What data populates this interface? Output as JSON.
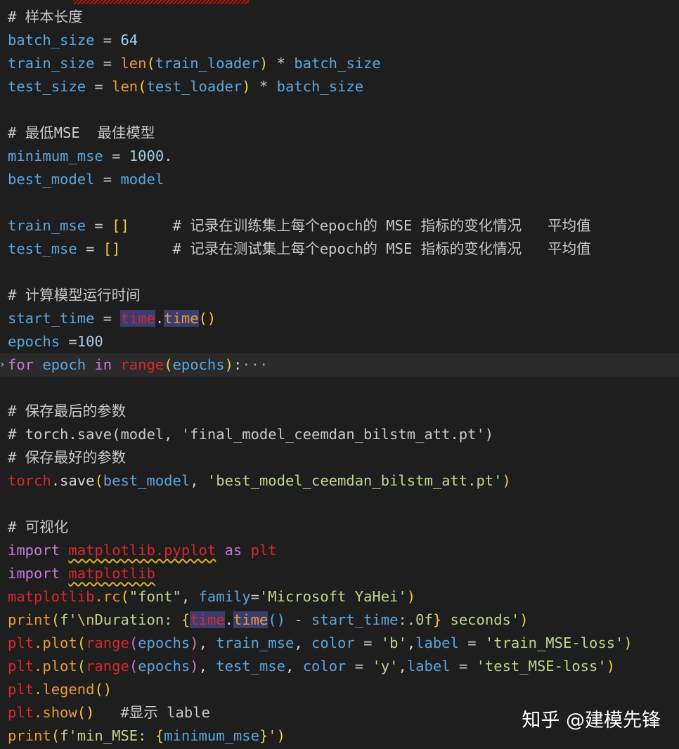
{
  "editor": {
    "lines": [
      [
        {
          "t": "# 样本长度",
          "c": "cm"
        }
      ],
      [
        {
          "t": "batch_size",
          "c": "var"
        },
        {
          "t": " = ",
          "c": "op"
        },
        {
          "t": "64",
          "c": "num"
        }
      ],
      [
        {
          "t": "train_size",
          "c": "var"
        },
        {
          "t": " = ",
          "c": "op"
        },
        {
          "t": "len",
          "c": "fn"
        },
        {
          "t": "(",
          "c": "p1"
        },
        {
          "t": "train_loader",
          "c": "var"
        },
        {
          "t": ")",
          "c": "p1"
        },
        {
          "t": " * ",
          "c": "op"
        },
        {
          "t": "batch_size",
          "c": "var"
        }
      ],
      [
        {
          "t": "test_size",
          "c": "var"
        },
        {
          "t": " = ",
          "c": "op"
        },
        {
          "t": "len",
          "c": "fn"
        },
        {
          "t": "(",
          "c": "p1"
        },
        {
          "t": "test_loader",
          "c": "var"
        },
        {
          "t": ")",
          "c": "p1"
        },
        {
          "t": " * ",
          "c": "op"
        },
        {
          "t": "batch_size",
          "c": "var"
        }
      ],
      [],
      [
        {
          "t": "# 最低MSE  最佳模型",
          "c": "cm"
        }
      ],
      [
        {
          "t": "minimum_mse",
          "c": "var"
        },
        {
          "t": " = ",
          "c": "op"
        },
        {
          "t": "1000.",
          "c": "num"
        }
      ],
      [
        {
          "t": "best_model",
          "c": "var"
        },
        {
          "t": " = ",
          "c": "op"
        },
        {
          "t": "model",
          "c": "var"
        }
      ],
      [],
      [
        {
          "t": "train_mse",
          "c": "var"
        },
        {
          "t": " = ",
          "c": "op"
        },
        {
          "t": "[]",
          "c": "p1"
        },
        {
          "t": "     # 记录在训练集上每个epoch的 MSE 指标的变化情况   平均值",
          "c": "cm"
        }
      ],
      [
        {
          "t": "test_mse",
          "c": "var"
        },
        {
          "t": " = ",
          "c": "op"
        },
        {
          "t": "[]",
          "c": "p1"
        },
        {
          "t": "      # 记录在测试集上每个epoch的 MSE 指标的变化情况   平均值",
          "c": "cm"
        }
      ],
      [],
      [
        {
          "t": "# 计算模型运行时间",
          "c": "cm"
        }
      ],
      [
        {
          "t": "start_time",
          "c": "var"
        },
        {
          "t": " = ",
          "c": "op"
        },
        {
          "t": "time",
          "c": "mod hl"
        },
        {
          "t": ".",
          "c": "txt"
        },
        {
          "t": "time",
          "c": "fn hl"
        },
        {
          "t": "()",
          "c": "p1"
        }
      ],
      [
        {
          "t": "epochs",
          "c": "var"
        },
        {
          "t": " =",
          "c": "op"
        },
        {
          "t": "100",
          "c": "num"
        }
      ],
      [
        {
          "t": "for",
          "c": "kw"
        },
        {
          "t": " epoch ",
          "c": "var"
        },
        {
          "t": "in",
          "c": "kw"
        },
        {
          "t": " ",
          "c": "txt"
        },
        {
          "t": "range",
          "c": "mod"
        },
        {
          "t": "(",
          "c": "p1"
        },
        {
          "t": "epochs",
          "c": "var"
        },
        {
          "t": ")",
          "c": "p1"
        },
        {
          "t": ":",
          "c": "txt"
        },
        {
          "t": "···",
          "c": "dim"
        }
      ],
      [],
      [
        {
          "t": "# 保存最后的参数",
          "c": "cm"
        }
      ],
      [
        {
          "t": "# torch.save(model, 'final_model_ceemdan_bilstm_att.pt')",
          "c": "cm"
        }
      ],
      [
        {
          "t": "# 保存最好的参数",
          "c": "cm"
        }
      ],
      [
        {
          "t": "torch",
          "c": "mod"
        },
        {
          "t": ".save",
          "c": "txt"
        },
        {
          "t": "(",
          "c": "p1"
        },
        {
          "t": "best_model",
          "c": "var"
        },
        {
          "t": ", ",
          "c": "txt"
        },
        {
          "t": "'best_model_ceemdan_bilstm_att.pt'",
          "c": "str"
        },
        {
          "t": ")",
          "c": "p1"
        }
      ],
      [],
      [
        {
          "t": "# 可视化",
          "c": "cm"
        }
      ],
      [
        {
          "t": "import",
          "c": "kw"
        },
        {
          "t": " ",
          "c": "txt"
        },
        {
          "t": "matplotlib.pyplot",
          "c": "mod sq"
        },
        {
          "t": " as ",
          "c": "kw"
        },
        {
          "t": "plt",
          "c": "mod"
        }
      ],
      [
        {
          "t": "import",
          "c": "kw"
        },
        {
          "t": " ",
          "c": "txt"
        },
        {
          "t": "matplotlib",
          "c": "mod sq"
        }
      ],
      [
        {
          "t": "matplotlib",
          "c": "mod"
        },
        {
          "t": ".rc",
          "c": "fn"
        },
        {
          "t": "(",
          "c": "p1"
        },
        {
          "t": "\"font\"",
          "c": "str"
        },
        {
          "t": ", ",
          "c": "txt"
        },
        {
          "t": "family",
          "c": "var"
        },
        {
          "t": "=",
          "c": "op"
        },
        {
          "t": "'Microsoft YaHei'",
          "c": "str"
        },
        {
          "t": ")",
          "c": "p1"
        }
      ],
      [
        {
          "t": "print",
          "c": "fn"
        },
        {
          "t": "(",
          "c": "p1"
        },
        {
          "t": "f'",
          "c": "str"
        },
        {
          "t": "\\n",
          "c": "esc"
        },
        {
          "t": "Duration: ",
          "c": "str"
        },
        {
          "t": "{",
          "c": "p1"
        },
        {
          "t": "time",
          "c": "mod hl"
        },
        {
          "t": ".",
          "c": "txt"
        },
        {
          "t": "time",
          "c": "fn hl"
        },
        {
          "t": "()",
          "c": "p3"
        },
        {
          "t": " - ",
          "c": "op"
        },
        {
          "t": "start_time",
          "c": "var"
        },
        {
          "t": ":.0f",
          "c": "str"
        },
        {
          "t": "}",
          "c": "p1"
        },
        {
          "t": " seconds'",
          "c": "str"
        },
        {
          "t": ")",
          "c": "p1"
        }
      ],
      [
        {
          "t": "plt",
          "c": "mod"
        },
        {
          "t": ".plot",
          "c": "fn"
        },
        {
          "t": "(",
          "c": "p1"
        },
        {
          "t": "range",
          "c": "mod"
        },
        {
          "t": "(",
          "c": "p2"
        },
        {
          "t": "epochs",
          "c": "var"
        },
        {
          "t": ")",
          "c": "p2"
        },
        {
          "t": ", ",
          "c": "txt"
        },
        {
          "t": "train_mse",
          "c": "var"
        },
        {
          "t": ", ",
          "c": "txt"
        },
        {
          "t": "color",
          "c": "var"
        },
        {
          "t": " = ",
          "c": "op"
        },
        {
          "t": "'b'",
          "c": "str"
        },
        {
          "t": ",",
          "c": "txt"
        },
        {
          "t": "label",
          "c": "var"
        },
        {
          "t": " = ",
          "c": "op"
        },
        {
          "t": "'train_MSE-loss'",
          "c": "str"
        },
        {
          "t": ")",
          "c": "p1"
        }
      ],
      [
        {
          "t": "plt",
          "c": "mod"
        },
        {
          "t": ".plot",
          "c": "fn"
        },
        {
          "t": "(",
          "c": "p1"
        },
        {
          "t": "range",
          "c": "mod"
        },
        {
          "t": "(",
          "c": "p2"
        },
        {
          "t": "epochs",
          "c": "var"
        },
        {
          "t": ")",
          "c": "p2"
        },
        {
          "t": ", ",
          "c": "txt"
        },
        {
          "t": "test_mse",
          "c": "var"
        },
        {
          "t": ", ",
          "c": "txt"
        },
        {
          "t": "color",
          "c": "var"
        },
        {
          "t": " = ",
          "c": "op"
        },
        {
          "t": "'y'",
          "c": "str"
        },
        {
          "t": ",",
          "c": "txt"
        },
        {
          "t": "label",
          "c": "var"
        },
        {
          "t": " = ",
          "c": "op"
        },
        {
          "t": "'test_MSE-loss'",
          "c": "str"
        },
        {
          "t": ")",
          "c": "p1"
        }
      ],
      [
        {
          "t": "plt",
          "c": "mod"
        },
        {
          "t": ".legend",
          "c": "fn"
        },
        {
          "t": "()",
          "c": "p1"
        }
      ],
      [
        {
          "t": "plt",
          "c": "mod"
        },
        {
          "t": ".show",
          "c": "fn"
        },
        {
          "t": "()",
          "c": "p1"
        },
        {
          "t": "   #显示 lable",
          "c": "cm"
        }
      ],
      [
        {
          "t": "print",
          "c": "fn"
        },
        {
          "t": "(",
          "c": "p1"
        },
        {
          "t": "f'min_MSE: ",
          "c": "str"
        },
        {
          "t": "{",
          "c": "p1"
        },
        {
          "t": "minimum_mse",
          "c": "var"
        },
        {
          "t": "}",
          "c": "p1"
        },
        {
          "t": "'",
          "c": "str"
        },
        {
          "t": ")",
          "c": "p1"
        }
      ]
    ]
  },
  "watermark": "知乎 @建模先锋",
  "colors": {
    "background": "#1e1e1e",
    "comment": "#c8c8c8",
    "variable": "#5aa6e0",
    "function": "#e99a3a",
    "keyword": "#c679dd",
    "string": "#bcd88c",
    "bracket": "#f5cb3d"
  },
  "icons": {
    "fold": "fold-arrow-icon"
  }
}
